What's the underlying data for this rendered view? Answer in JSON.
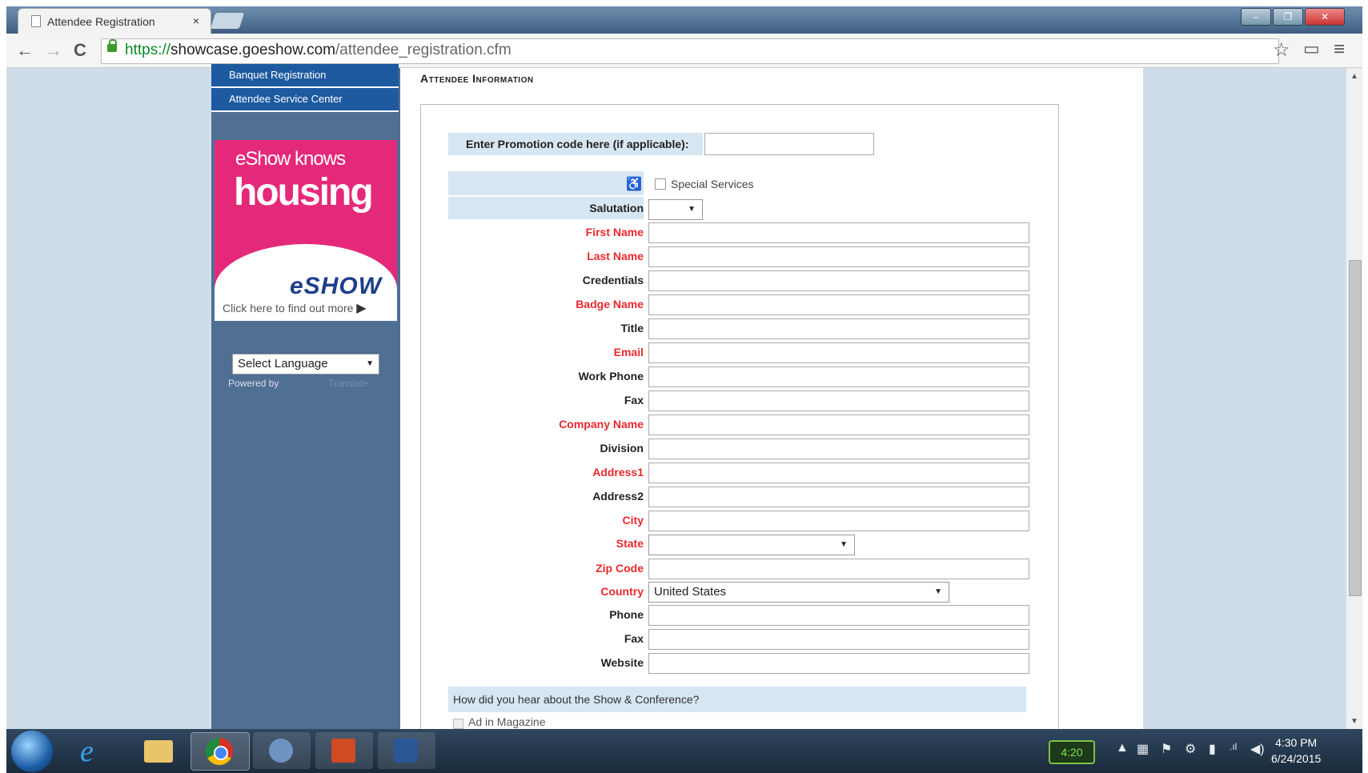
{
  "browser": {
    "tab_title": "Attendee Registration",
    "tab_close": "×",
    "url_scheme": "https://",
    "url_host": "showcase.goeshow.com",
    "url_path": "/attendee_registration.cfm",
    "back_glyph": "←",
    "forward_glyph": "→",
    "reload_glyph": "C",
    "star_glyph": "☆",
    "menu_glyph": "≡",
    "cast_glyph": "▭"
  },
  "sidebar": {
    "links": [
      "Banquet Registration",
      "Attendee Service Center"
    ],
    "ad": {
      "kicker": "eShow knows",
      "headline": "housing",
      "logo": "eSHOW",
      "cta": "Click here to find out more"
    },
    "language_select": "Select Language",
    "powered_by": "Powered by",
    "translate": "Translate"
  },
  "form": {
    "section_title": "Attendee Information",
    "promo_label": "Enter Promotion code here (if applicable):",
    "special_services_label": "Special Services",
    "salutation_label": "Salutation",
    "fields": [
      {
        "label": "First Name",
        "required": true
      },
      {
        "label": "Last Name",
        "required": true
      },
      {
        "label": "Credentials",
        "required": false
      },
      {
        "label": "Badge Name",
        "required": true
      },
      {
        "label": "Title",
        "required": false
      },
      {
        "label": "Email",
        "required": true
      },
      {
        "label": "Work Phone",
        "required": false
      },
      {
        "label": "Fax",
        "required": false
      },
      {
        "label": "Company Name",
        "required": true
      },
      {
        "label": "Division",
        "required": false
      },
      {
        "label": "Address1",
        "required": true
      },
      {
        "label": "Address2",
        "required": false
      },
      {
        "label": "City",
        "required": true
      }
    ],
    "state_label": "State",
    "zip_label": "Zip Code",
    "country_label": "Country",
    "country_value": "United States",
    "fields2": [
      {
        "label": "Phone",
        "required": false
      },
      {
        "label": "Fax",
        "required": false
      },
      {
        "label": "Website",
        "required": false
      }
    ],
    "heard_question": "How did you hear about the Show & Conference?",
    "heard_first_option": "Ad in Magazine"
  },
  "taskbar": {
    "battery": "4:20",
    "time": "4:30 PM",
    "date": "6/24/2015"
  },
  "colors": {
    "required_label": "#e8282e",
    "sidebar_bg": "#4f6f93",
    "nav_link_bg": "#1e5aa0",
    "ad_pink": "#e5297a",
    "label_bar": "#d6e6f2"
  }
}
